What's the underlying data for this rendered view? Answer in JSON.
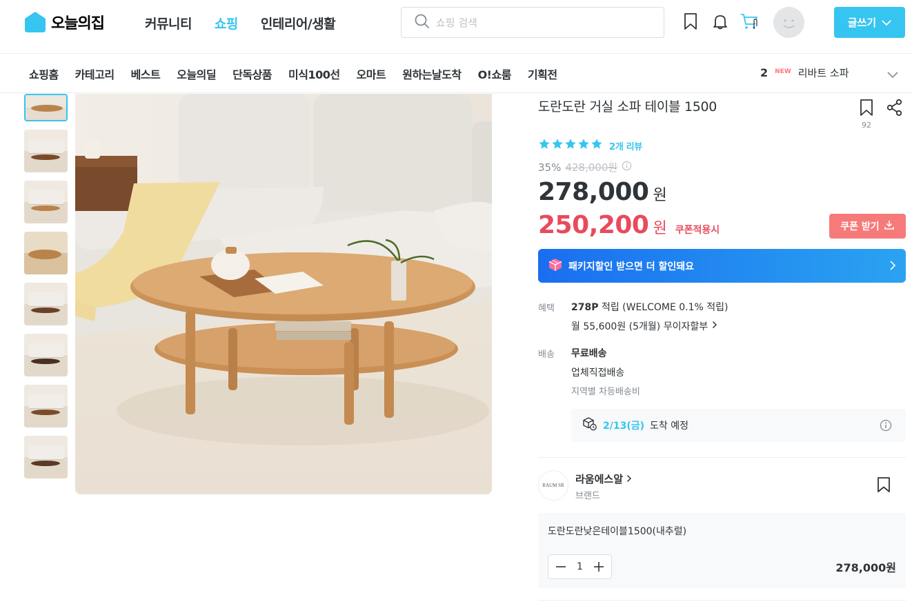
{
  "header": {
    "logo_text": "오늘의집",
    "nav": [
      "커뮤니티",
      "쇼핑",
      "인테리어/생활"
    ],
    "active_nav_index": 1,
    "search_placeholder": "쇼핑 검색",
    "write_label": "글쓰기",
    "accent_color": "#35c5f0"
  },
  "subnav": {
    "items": [
      "쇼핑홈",
      "카테고리",
      "베스트",
      "오늘의딜",
      "단독상품",
      "미식100선",
      "오마트",
      "원하는날도착",
      "O!쇼룸",
      "기획전"
    ],
    "ranking": {
      "rank": "2",
      "badge": "NEW",
      "keyword": "리바트 소파"
    }
  },
  "gallery": {
    "thumbnail_count": 8,
    "selected_index": 0
  },
  "product": {
    "name": "도란도란 거실 소파 테이블 1500",
    "scrap_count": "92",
    "rating_stars": 5,
    "review_text": "2개 리뷰",
    "discount_rate": "35%",
    "original_price": "428,000원",
    "price": "278,000",
    "price_unit": "원",
    "coupon_price": "250,200",
    "coupon_unit": "원",
    "coupon_label": "쿠폰적용시",
    "coupon_button": "쿠폰 받기",
    "package_banner": "패키지할인 받으면 더 할인돼요"
  },
  "benefits": {
    "label": "혜택",
    "points": "278P",
    "points_text": "적립 (WELCOME 0.1% 적립)",
    "installment": "월 55,600원 (5개월) 무이자할부"
  },
  "delivery": {
    "label": "배송",
    "type": "무료배송",
    "method": "업체직접배송",
    "note": "지역별 차등배송비",
    "arrival_date": "2/13(금)",
    "arrival_text": "도착 예정"
  },
  "brand": {
    "logo_text": "RAUM SR",
    "name": "라움에스알",
    "sub": "브랜드"
  },
  "option": {
    "name": "도란도란낮은테이블1500(내추럴)",
    "quantity": "1",
    "price": "278,000원"
  },
  "colors": {
    "accent": "#35c5f0",
    "sale": "#e94a5d",
    "coupon_button": "#f77a7a"
  }
}
